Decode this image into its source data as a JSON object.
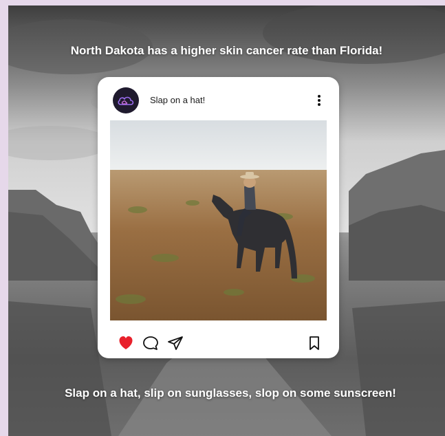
{
  "headline": "North Dakota has a higher skin cancer rate than Florida!",
  "post": {
    "username": "Slap on a hat!",
    "avatar_icon": "cloud-logo-icon",
    "actions": {
      "like_icon": "heart-icon",
      "comment_icon": "comment-icon",
      "share_icon": "send-icon",
      "save_icon": "bookmark-icon",
      "more_icon": "more-vertical-icon"
    }
  },
  "caption": "Slap on  a hat, slip on sunglasses, slop on some sunscreen!",
  "colors": {
    "page_border": "#e6d8ea",
    "like_red": "#e8202b",
    "avatar_bg": "#1f1a2e",
    "avatar_accent": "#9b6cf0",
    "text_white": "#ffffff"
  }
}
